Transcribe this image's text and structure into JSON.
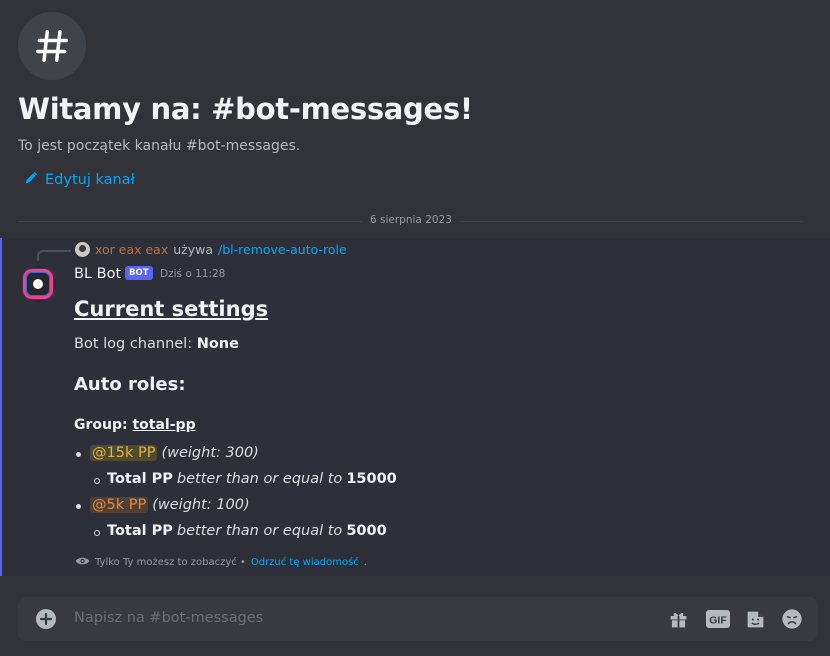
{
  "channel": {
    "icon": "hash-icon",
    "welcome_title": "Witamy na: #bot-messages!",
    "intro_text": "To jest początek kanału #bot-messages.",
    "edit_label": "Edytuj kanał"
  },
  "date_divider": "6 sierpnia 2023",
  "message": {
    "reply": {
      "user": "xor eax eax",
      "verb": "używa",
      "command": "/bl-remove-auto-role"
    },
    "author": "BL Bot",
    "bot_tag": "BOT",
    "timestamp": "Dziś o 11:28",
    "heading": "Current settings",
    "log_label": "Bot log channel:",
    "log_value": "None",
    "roles_heading": "Auto roles:",
    "group_label": "Group:",
    "group_name": "total-pp",
    "roles": [
      {
        "mention": "@15k PP",
        "weight": "(weight: 300)",
        "cond_bold": "Total PP",
        "cond_text": "better than or equal to",
        "cond_value": "15000"
      },
      {
        "mention": "@5k PP",
        "weight": "(weight: 100)",
        "cond_bold": "Total PP",
        "cond_text": "better than or equal to",
        "cond_value": "5000"
      }
    ],
    "ephemeral_text": "Tylko Ty możesz to zobaczyć •",
    "dismiss_link": "Odrzuć tę wiadomość",
    "dismiss_suffix": "."
  },
  "composer": {
    "placeholder": "Napisz na #bot-messages",
    "tools": [
      "gift-icon",
      "gif-icon",
      "sticker-icon",
      "emoji-icon"
    ],
    "gif_label": "GIF"
  },
  "colors": {
    "accent": "#5865f2",
    "link": "#00a8fc",
    "mention_15k": "#e3b341",
    "mention_5k": "#e28a43"
  }
}
